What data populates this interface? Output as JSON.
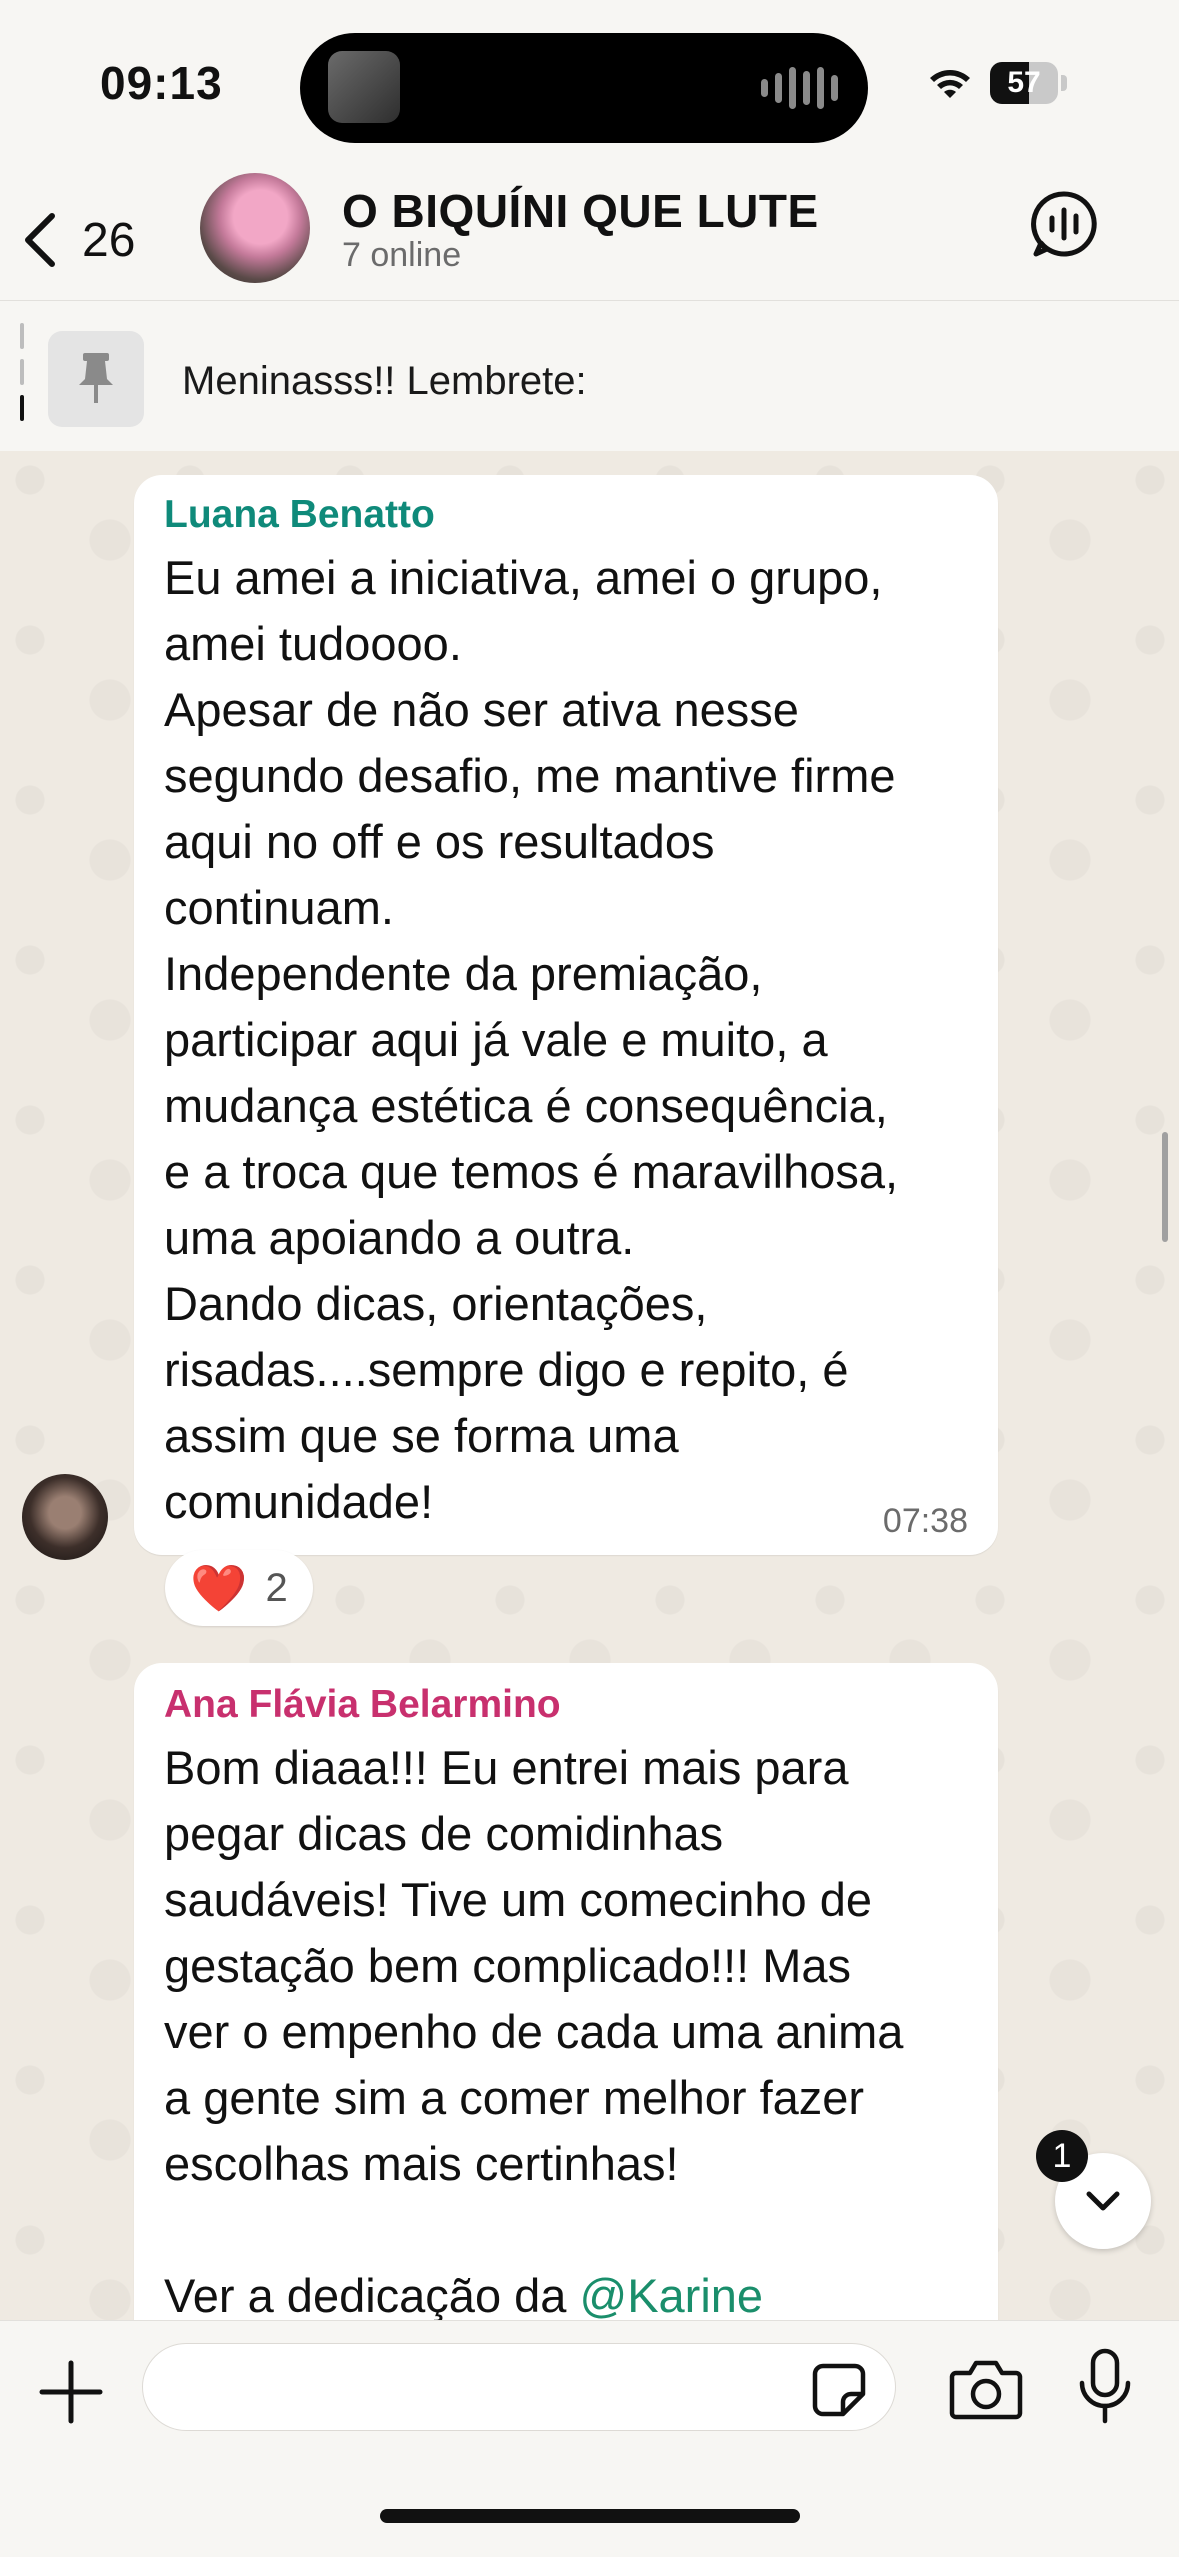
{
  "status_bar": {
    "time": "09:13",
    "battery": "57",
    "battery_level_percent": 57
  },
  "header": {
    "back_count": "26",
    "title": "O BIQUÍNI QUE LUTE",
    "subtitle": "7 online",
    "pinned_text": "Meninasss!! Lembrete:"
  },
  "messages": [
    {
      "sender": "Luana Benatto",
      "sender_color": "#0f8a7a",
      "text": "Eu amei a iniciativa, amei o grupo,\namei tudoooo.\nApesar de não ser ativa nesse\nsegundo desafio, me mantive firme\naqui no off e os resultados\ncontinuam.\nIndependente da premiação,\nparticipar aqui já vale e muito, a\nmudança estética é consequência,\ne a troca que temos é maravilhosa,\numa apoiando a outra.\nDando dicas, orientações,\nrisadas....sempre digo e repito, é\nassim que se forma uma\ncomunidade!",
      "time": "07:38",
      "reaction_emoji": "❤️",
      "reaction_count": "2"
    },
    {
      "sender": "Ana Flávia Belarmino",
      "sender_color": "#c8306e",
      "text": "Bom diaaa!!! Eu entrei mais para\npegar dicas de comidinhas\nsaudáveis! Tive um comecinho de\ngestação bem complicado!!! Mas\nver o empenho de cada uma anima\na gente sim a comer melhor fazer\nescolhas mais certinhas!\n\nVer a dedicação da ",
      "mention": "@Karine"
    }
  ],
  "scroll": {
    "unread_count": "1"
  },
  "input": {
    "placeholder": ""
  },
  "icons": {
    "back": "chevron-left-icon",
    "call": "group-call-icon",
    "pin": "pin-icon",
    "plus": "plus-icon",
    "sticker": "sticker-icon",
    "camera": "camera-icon",
    "mic": "microphone-icon",
    "scroll_down": "chevron-down-icon"
  }
}
